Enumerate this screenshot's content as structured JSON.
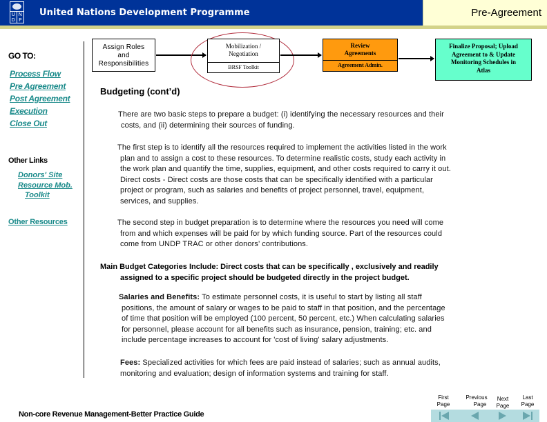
{
  "header": {
    "org_name": "United Nations Development Programme",
    "logo_letters": [
      "U",
      "N",
      "D",
      "P"
    ],
    "section_title": "Pre-Agreement"
  },
  "sidebar": {
    "goto_label": "GO TO:",
    "nav_links": [
      {
        "label": "Process Flow"
      },
      {
        "label": "Pre Agreement"
      },
      {
        "label": "Post Agreement"
      },
      {
        "label": "Execution"
      },
      {
        "label": "Close Out"
      }
    ],
    "other_links_label": "Other Links",
    "other_links": [
      {
        "label": "Donors' Site"
      },
      {
        "label": "Resource Mob."
      },
      {
        "label": "Toolkit"
      }
    ],
    "other_resources": "Other Resources"
  },
  "flow": {
    "assign": {
      "lines": [
        "Assign Roles",
        "and",
        "Responsibilities"
      ]
    },
    "mobilization": {
      "lines": [
        "Mobilization /",
        "Negotiation"
      ],
      "sub": "BRSF Toolkit"
    },
    "review": {
      "lines": [
        "Review",
        "Agreements"
      ],
      "sub": "Agreement Admin."
    },
    "finalize": {
      "lines": [
        "Finalize Proposal; Upload",
        "Agreement to & Update",
        "Monitoring Schedules in",
        "Atlas"
      ]
    },
    "colors": {
      "review": "#ff9a0e",
      "finalize": "#66ffcc",
      "highlight": "#b02a3a"
    }
  },
  "content": {
    "heading": "Budgeting (cont’d)",
    "p1": [
      "There are two basic steps to prepare a budget: (i) identifying the necessary resources and their",
      "costs, and (ii)  determining their sources of funding."
    ],
    "p2": [
      "The first step is to identify all the resources required to implement the activities listed in the work",
      "plan and to assign a cost to these resources.  To determine realistic costs, study each activity in",
      "the work plan and quantify the time, supplies, equipment, and other costs required to carry it out.",
      "Direct costs - Direct costs are those costs that can be specifically identified with a particular",
      "project or program, such as salaries and benefits of project personnel, travel, equipment,",
      "services, and supplies."
    ],
    "p3": [
      "The second step in budget preparation is to determine where the resources you need will come",
      "from and which expenses will be paid for by which funding source.  Part of the resources could",
      "come from UNDP TRAC or other donors’ contributions."
    ],
    "main_categories": [
      "Main Budget Categories Include:  Direct costs that can be specifically , exclusively and readily",
      "assigned to a specific project should be budgeted directly in the project budget."
    ],
    "salaries": {
      "label": "Salaries and Benefits:",
      "first": "  To estimate personnel costs, it is useful to start by listing all staff",
      "lines": [
        "positions, the amount of salary or wages to be paid to staff in that position, and the percentage",
        "of time that  position will be employed (100 percent, 50 percent, etc.)  When calculating salaries",
        "for personnel, please account for all benefits such as insurance, pension, training; etc. and",
        "include percentage increases to account for 'cost of living' salary adjustments."
      ]
    },
    "fees": {
      "label": "Fees:",
      "first": "  Specialized activities for which fees are paid instead of salaries; such as annual audits,",
      "lines": [
        "monitoring and evaluation; design of information systems and training for staff."
      ]
    }
  },
  "footer": {
    "title": "Non-core Revenue Management-Better Practice Guide",
    "nav": [
      {
        "top": "First",
        "bottom": "Page"
      },
      {
        "top": "Previous",
        "bottom": "Page"
      },
      {
        "top": "Next",
        "bottom": "Page"
      },
      {
        "top": "Last",
        "bottom": "Page"
      }
    ]
  }
}
